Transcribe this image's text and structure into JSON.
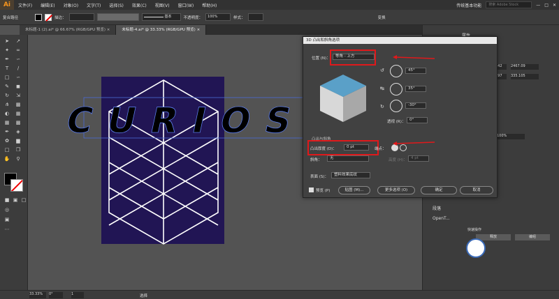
{
  "menubar": {
    "logo": "Ai",
    "items": [
      "文件(F)",
      "编辑(E)",
      "对象(O)",
      "文字(T)",
      "选择(S)",
      "效果(C)",
      "视图(V)",
      "窗口(W)",
      "帮助(H)"
    ],
    "workspace": "传统基本功能",
    "search_placeholder": "搜索 Adobe Stock"
  },
  "ctrlbar": {
    "selection": "复合路径",
    "stroke_label": "描边：",
    "stroke_style": "基本",
    "opacity_label": "不透明度：",
    "opacity": "100%",
    "style_label": "样式：",
    "transform": "变换"
  },
  "tabs": [
    {
      "label": "未标题-1 (2).ai* @ 66.67% (RGB/GPU 预览)",
      "close": "×"
    },
    {
      "label": "未标题-4.ai* @ 33.33% (RGB/GPU 预览)",
      "close": "×"
    }
  ],
  "canvas": {
    "text": "CURIOS"
  },
  "rightpanel": {
    "tab": "属性",
    "v1": "042",
    "v2": "2467.09",
    "v3": "997",
    "v4": "335.105",
    "v5": "100%",
    "items": [
      "段落",
      "OpenT..."
    ],
    "quick_actions": "快速操作",
    "btn_a": "释放",
    "btn_b": "编组"
  },
  "dialog": {
    "title": "3D 凸出和斜角选项",
    "position_label": "位置 (N)：",
    "position_value": "等角 - 上方",
    "angle_x": "45°",
    "angle_y": "35°",
    "angle_z": "-30°",
    "perspective_label": "透视 (R)：",
    "perspective_value": "0°",
    "extrude_section": "凸出与斜角",
    "extrude_label": "凸出厚度 (D)：",
    "extrude_value": "0 pt",
    "cap_label": "端点：",
    "bevel_label": "斜角：",
    "bevel_value": "无",
    "height_label": "高度 (H)：",
    "height_value": "4 pt",
    "surface_label": "表面 (S)：",
    "surface_value": "塑料效果底纹",
    "preview_label": "预览 (P)",
    "map_button": "贴图 (M)...",
    "more_button": "更多选项 (O)",
    "ok_button": "确定",
    "cancel_button": "取消"
  },
  "statusbar": {
    "zoom": "33.33%",
    "angle": "0°",
    "page": "1",
    "mode": "选择"
  },
  "colors": {
    "artboard": "#211554",
    "accent": "#e0191b",
    "cube_top": "#5aa0c8"
  }
}
